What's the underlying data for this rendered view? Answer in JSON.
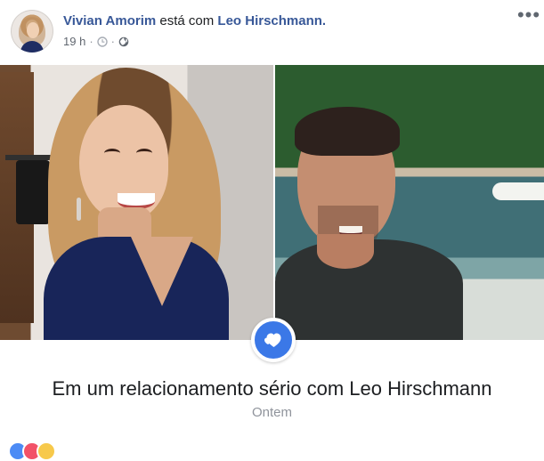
{
  "header": {
    "author": "Vivian Amorim",
    "connector": "está com",
    "tagged": "Leo Hirschmann.",
    "timestamp": "19 h",
    "separator": "·",
    "more_label": "•••"
  },
  "icons": {
    "avatar": "profile-photo",
    "clock": "clock-icon",
    "globe": "globe-icon",
    "heart": "heart-icon"
  },
  "event": {
    "relationship": "Em um relacionamento sério com Leo Hirschmann",
    "date": "Ontem"
  },
  "colors": {
    "link": "#385898",
    "badge": "#3b78e7",
    "muted": "#90949c"
  }
}
